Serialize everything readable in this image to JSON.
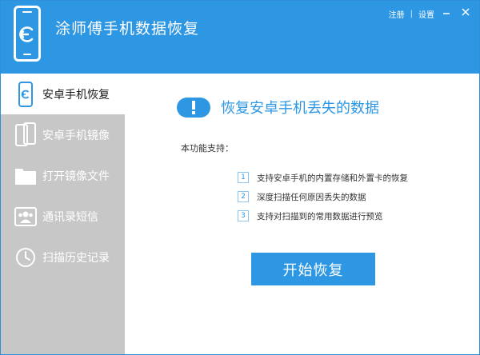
{
  "app": {
    "title": "涂师傅手机数据恢复"
  },
  "top_links": {
    "register": "注册",
    "separator": "|",
    "settings": "设置"
  },
  "sidebar": {
    "items": [
      {
        "label": "安卓手机恢复",
        "icon": "phone-restore-icon",
        "active": true
      },
      {
        "label": "安卓手机镜像",
        "icon": "phone-mirror-icon",
        "active": false
      },
      {
        "label": "打开镜像文件",
        "icon": "folder-icon",
        "active": false
      },
      {
        "label": "通讯录短信",
        "icon": "contacts-icon",
        "active": false
      },
      {
        "label": "扫描历史记录",
        "icon": "clock-icon",
        "active": false
      }
    ]
  },
  "main": {
    "headline": "恢复安卓手机丢失的数据",
    "intro": "本功能支持：",
    "features": [
      {
        "num": "1",
        "text": "支持安卓手机的内置存储和外置卡的恢复"
      },
      {
        "num": "2",
        "text": "深度扫描任何原因丢失的数据"
      },
      {
        "num": "3",
        "text": "支持对扫描到的常用数据进行预览"
      }
    ],
    "start_button": "开始恢复"
  },
  "colors": {
    "accent": "#2e97e3",
    "sidebar": "#c7c7c7",
    "window_bg": "#ffffff"
  }
}
